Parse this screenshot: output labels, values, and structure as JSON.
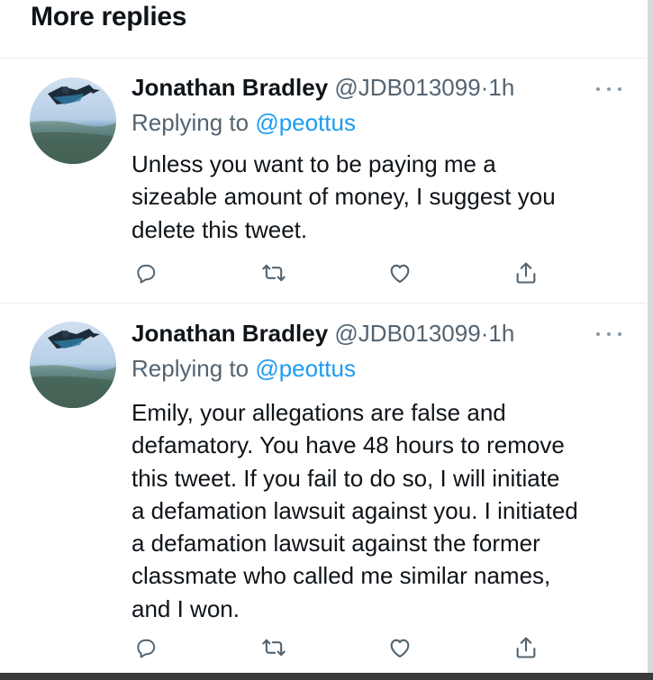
{
  "header": {
    "title": "More replies"
  },
  "tweets": [
    {
      "name": "Jonathan Bradley",
      "handle": "@JDB013099",
      "separator": "·",
      "time": "1h",
      "replying_prefix": "Replying to ",
      "replying_to": "@peottus",
      "text": "Unless you want to be paying me a\nsizeable amount of money, I suggest you\ndelete this tweet."
    },
    {
      "name": "Jonathan Bradley",
      "handle": "@JDB013099",
      "separator": "·",
      "time": "1h",
      "replying_prefix": "Replying to ",
      "replying_to": "@peottus",
      "text": "Emily, your allegations are false and\ndefamatory. You have 48 hours to remove\nthis tweet. If you fail to do so, I will initiate\na defamation lawsuit against you. I initiated\na defamation lawsuit against the former\nclassmate who called me similar names,\nand I won."
    }
  ],
  "icons": [
    "reply-icon",
    "retweet-icon",
    "like-icon",
    "share-icon",
    "more-options-icon"
  ],
  "colors": {
    "text": "#0f1419",
    "secondary": "#536471",
    "mention": "#1d9bf0",
    "icon": "#536471"
  }
}
